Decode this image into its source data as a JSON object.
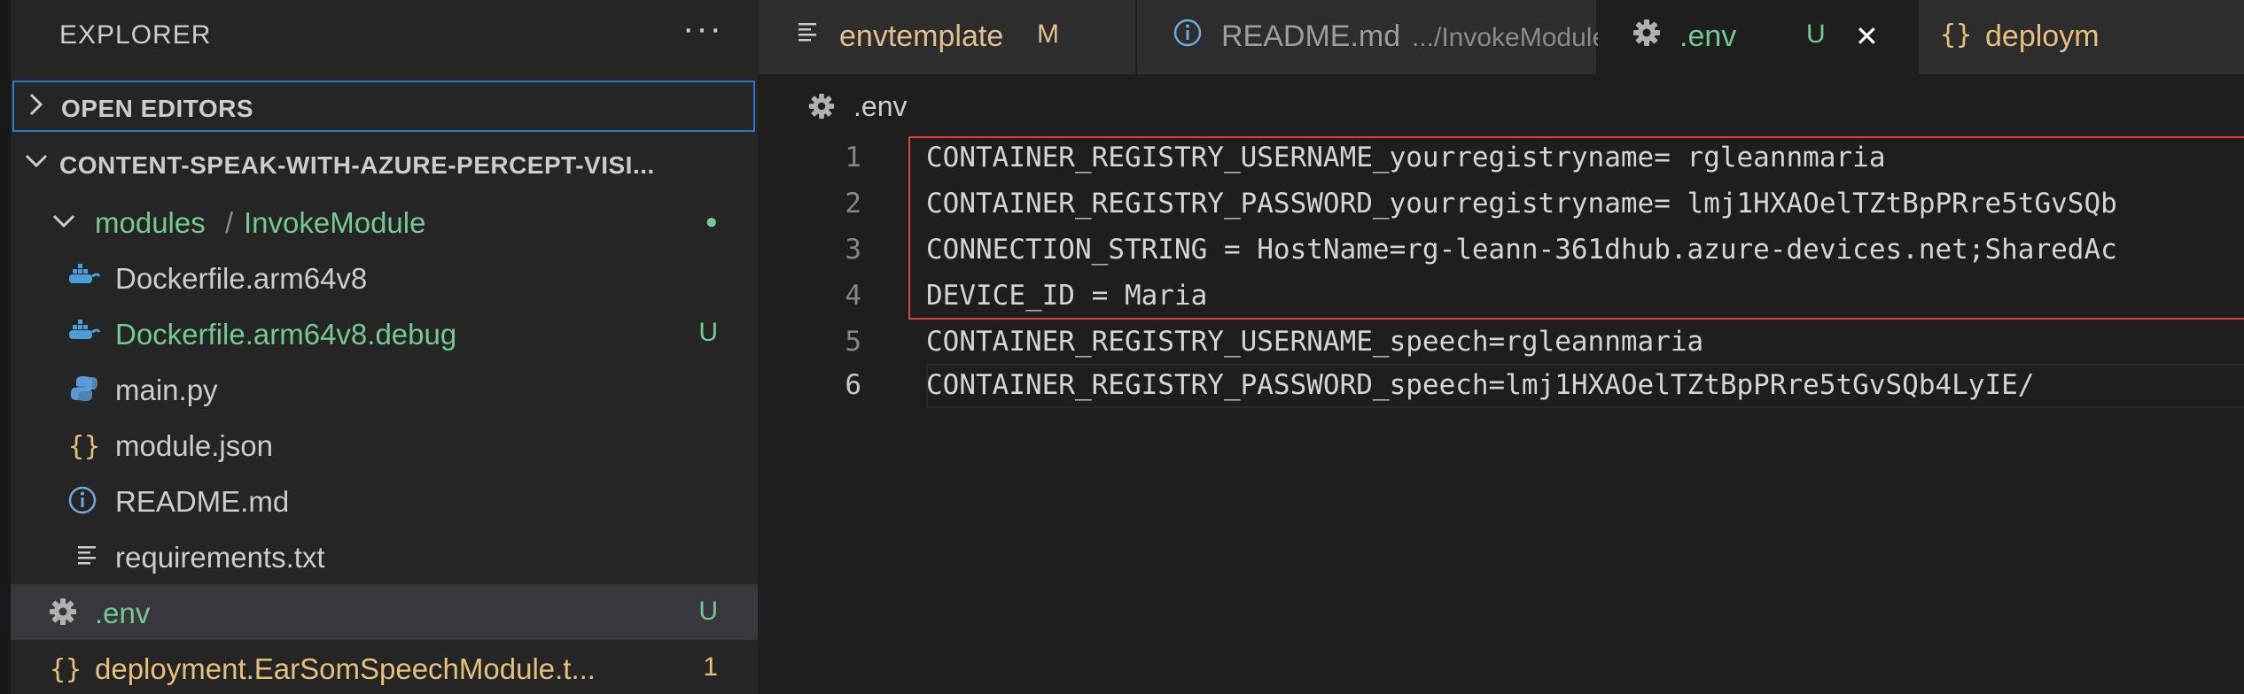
{
  "sidebar": {
    "title": "EXPLORER",
    "more": "···",
    "open_editors": "OPEN EDITORS",
    "project": "CONTENT-SPEAK-WITH-AZURE-PERCEPT-VISI...",
    "folder_a": "modules",
    "folder_sep": "/",
    "folder_b": "InvokeModule",
    "folder_dot": "●",
    "files": [
      {
        "name": "Dockerfile.arm64v8",
        "badge": ""
      },
      {
        "name": "Dockerfile.arm64v8.debug",
        "badge": "U"
      },
      {
        "name": "main.py",
        "badge": ""
      },
      {
        "name": "module.json",
        "badge": ""
      },
      {
        "name": "README.md",
        "badge": ""
      },
      {
        "name": "requirements.txt",
        "badge": ""
      },
      {
        "name": ".env",
        "badge": "U"
      },
      {
        "name": "deployment.EarSomSpeechModule.t...",
        "badge": "1"
      }
    ]
  },
  "tabs": [
    {
      "label": "envtemplate",
      "badge": "M"
    },
    {
      "label": "README.md",
      "sub": ".../InvokeModule"
    },
    {
      "label": ".env",
      "badge": "U",
      "close": "✕"
    },
    {
      "label": "deploym"
    }
  ],
  "editor": {
    "breadcrumb": ".env",
    "lines": [
      {
        "n": "1",
        "text": "CONTAINER_REGISTRY_USERNAME_yourregistryname= rgleannmaria"
      },
      {
        "n": "2",
        "text": "CONTAINER_REGISTRY_PASSWORD_yourregistryname= lmj1HXAOelTZtBpPRre5tGvSQb"
      },
      {
        "n": "3",
        "text": "CONNECTION_STRING = HostName=rg-leann-361dhub.azure-devices.net;SharedAc"
      },
      {
        "n": "4",
        "text": "DEVICE_ID = Maria"
      },
      {
        "n": "5",
        "text": "CONTAINER_REGISTRY_USERNAME_speech=rgleannmaria"
      },
      {
        "n": "6",
        "text": "CONTAINER_REGISTRY_PASSWORD_speech=lmj1HXAOelTZtBpPRre5tGvSQb4LyIE/"
      }
    ]
  },
  "colors": {
    "git_untracked": "#73c991",
    "git_modified": "#e2c08d",
    "json_file": "#e5c07b",
    "highlight_box": "#e0413a",
    "focus_border": "#2f74d0"
  },
  "icons": {
    "gear": "gear-icon",
    "docker": "docker-whale-icon",
    "python": "python-icon",
    "json": "json-braces-icon",
    "info": "info-icon",
    "text": "text-lines-icon"
  }
}
